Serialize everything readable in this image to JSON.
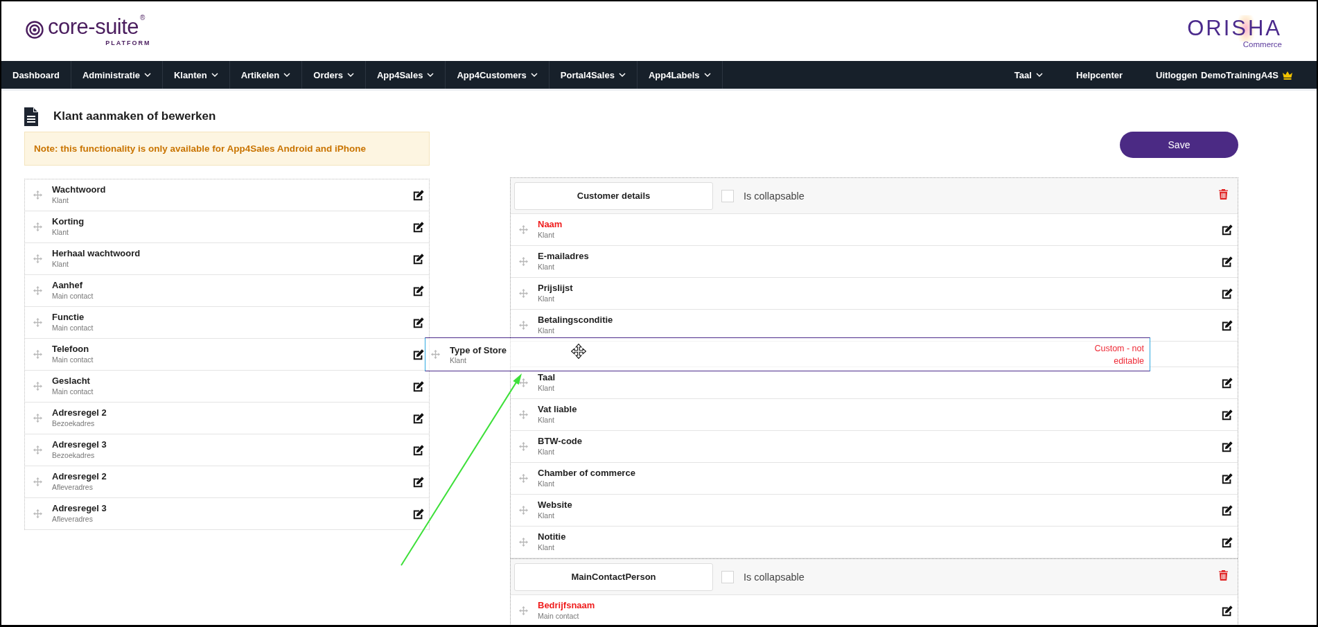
{
  "header": {
    "logo": {
      "name": "core-suite",
      "registered": "®",
      "tagline": "PLATFORM"
    },
    "brand": {
      "name": "ORISHA",
      "tagline": "Commerce"
    }
  },
  "nav": {
    "items": [
      {
        "label": "Dashboard",
        "dropdown": false
      },
      {
        "label": "Administratie",
        "dropdown": true
      },
      {
        "label": "Klanten",
        "dropdown": true
      },
      {
        "label": "Artikelen",
        "dropdown": true
      },
      {
        "label": "Orders",
        "dropdown": true
      },
      {
        "label": "App4Sales",
        "dropdown": true
      },
      {
        "label": "App4Customers",
        "dropdown": true
      },
      {
        "label": "Portal4Sales",
        "dropdown": true
      },
      {
        "label": "App4Labels",
        "dropdown": true
      }
    ],
    "right": [
      {
        "label": "Taal",
        "dropdown": true
      },
      {
        "label": "Helpcenter",
        "dropdown": false
      }
    ],
    "logout": "Uitloggen",
    "user": "DemoTrainingA4S"
  },
  "page": {
    "title": "Klant aanmaken of bewerken",
    "note": "Note: this functionality is only available for App4Sales Android and iPhone",
    "save": "Save"
  },
  "available_fields": [
    {
      "name": "Wachtwoord",
      "source": "Klant"
    },
    {
      "name": "Korting",
      "source": "Klant"
    },
    {
      "name": "Herhaal wachtwoord",
      "source": "Klant"
    },
    {
      "name": "Aanhef",
      "source": "Main contact"
    },
    {
      "name": "Functie",
      "source": "Main contact"
    },
    {
      "name": "Telefoon",
      "source": "Main contact"
    },
    {
      "name": "Geslacht",
      "source": "Main contact"
    },
    {
      "name": "Adresregel 2",
      "source": "Bezoekadres"
    },
    {
      "name": "Adresregel 3",
      "source": "Bezoekadres"
    },
    {
      "name": "Adresregel 2",
      "source": "Afleveradres"
    },
    {
      "name": "Adresregel 3",
      "source": "Afleveradres"
    }
  ],
  "sections": [
    {
      "title": "Customer details",
      "collapsable_label": "Is collapsable",
      "collapsable": false,
      "fields": [
        {
          "kind": "field",
          "name": "Naam",
          "source": "Klant",
          "required": true
        },
        {
          "kind": "field",
          "name": "E-mailadres",
          "source": "Klant",
          "required": false
        },
        {
          "kind": "field",
          "name": "Prijslijst",
          "source": "Klant",
          "required": false
        },
        {
          "kind": "field",
          "name": "Betalingsconditie",
          "source": "Klant",
          "required": false
        },
        {
          "kind": "drop-placeholder"
        },
        {
          "kind": "field",
          "name": "Taal",
          "source": "Klant",
          "required": false
        },
        {
          "kind": "field",
          "name": "Vat liable",
          "source": "Klant",
          "required": false
        },
        {
          "kind": "field",
          "name": "BTW-code",
          "source": "Klant",
          "required": false
        },
        {
          "kind": "field",
          "name": "Chamber of commerce",
          "source": "Klant",
          "required": false
        },
        {
          "kind": "field",
          "name": "Website",
          "source": "Klant",
          "required": false
        },
        {
          "kind": "field",
          "name": "Notitie",
          "source": "Klant",
          "required": false
        }
      ]
    },
    {
      "title": "MainContactPerson",
      "collapsable_label": "Is collapsable",
      "collapsable": false,
      "fields": [
        {
          "kind": "field",
          "name": "Bedrijfsnaam",
          "source": "Main contact",
          "required": true
        }
      ]
    }
  ],
  "drag": {
    "name": "Type of Store",
    "source": "Klant",
    "note": "Custom - not editable"
  }
}
